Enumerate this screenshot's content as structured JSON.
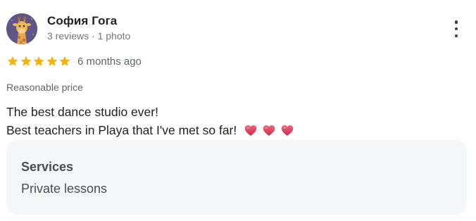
{
  "reviewer": {
    "name": "София Гога",
    "meta": "3 reviews · 1 photo",
    "avatar_icon": "giraffe-avatar"
  },
  "rating": {
    "stars": 5,
    "max": 5,
    "star_color": "#f4b400",
    "time_ago": "6 months ago"
  },
  "tag": "Reasonable price",
  "review_text": {
    "line1": "The best dance studio ever!",
    "line2": "Best teachers in Playa that I've met so far!",
    "emoji": [
      "heart-icon",
      "heart-icon",
      "heart-icon"
    ]
  },
  "services": {
    "title": "Services",
    "value": "Private lessons"
  },
  "menu_icon": "more-vert-icon",
  "colors": {
    "text_primary": "#202124",
    "text_secondary": "#70757a",
    "services_bg": "#f5f6f8",
    "heart": "#e0435a"
  }
}
